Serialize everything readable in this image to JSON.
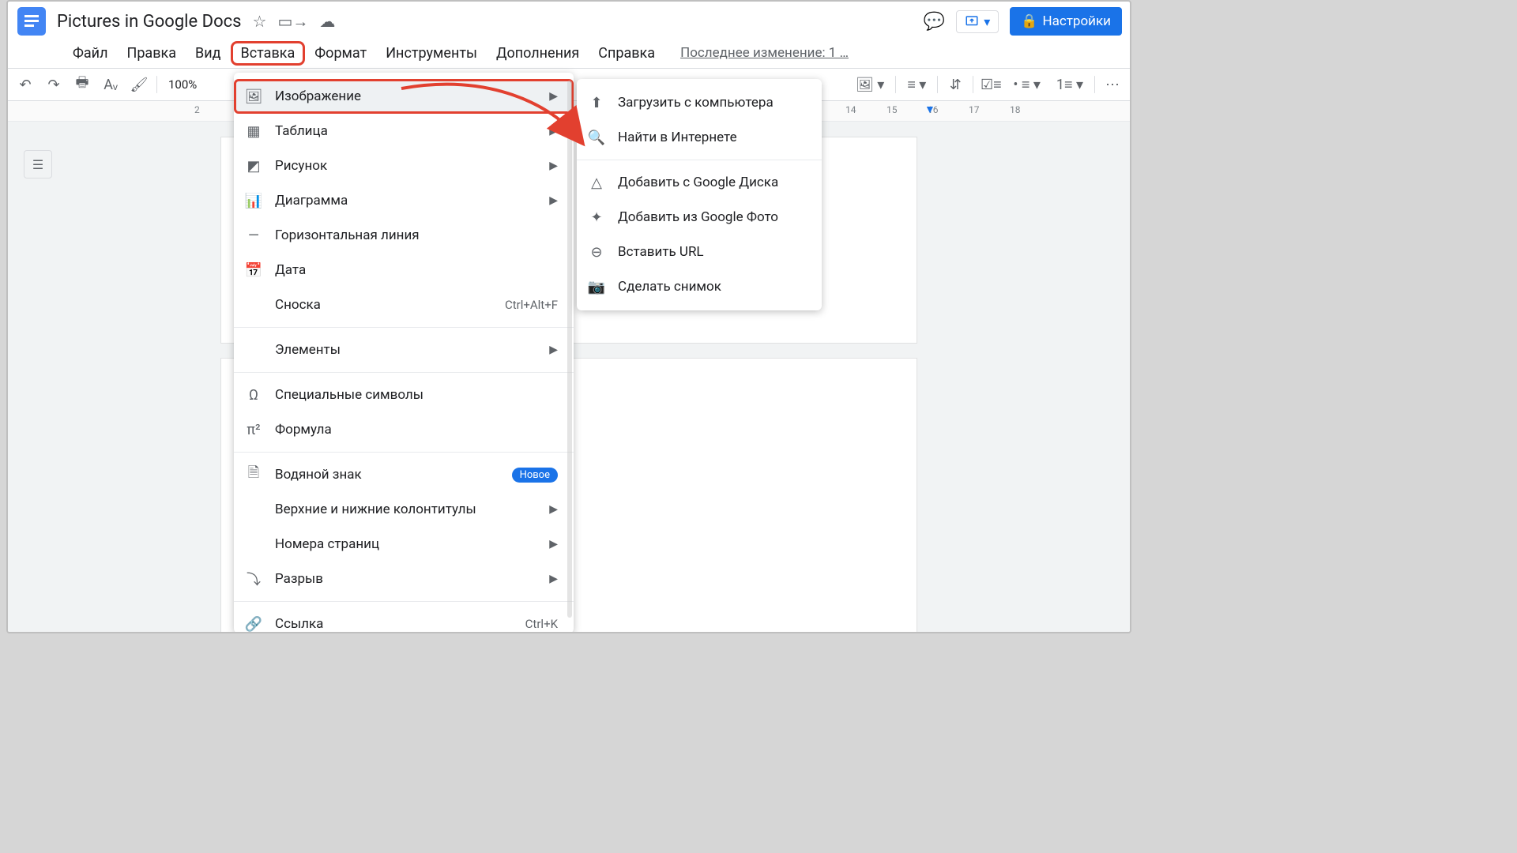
{
  "title": "Pictures in Google Docs",
  "lastedit": "Последнее изменение: 1 …",
  "share": "Настройки",
  "zoom": "100%",
  "menubar": [
    "Файл",
    "Правка",
    "Вид",
    "Вставка",
    "Формат",
    "Инструменты",
    "Дополнения",
    "Справка"
  ],
  "menubar_boxed_index": 3,
  "ruler_labels": [
    "2",
    "14",
    "15",
    "16",
    "17",
    "18"
  ],
  "insert_menu": [
    {
      "ico": "image",
      "label": "Изображение",
      "arrow": true,
      "selected": true,
      "boxed": true
    },
    {
      "ico": "table",
      "label": "Таблица",
      "arrow": true
    },
    {
      "ico": "drawing",
      "label": "Рисунок",
      "arrow": true
    },
    {
      "ico": "chart",
      "label": "Диаграмма",
      "arrow": true
    },
    {
      "ico": "hr",
      "label": "Горизонтальная линия"
    },
    {
      "ico": "date",
      "label": "Дата"
    },
    {
      "ico": "",
      "label": "Сноска",
      "shortcut": "Ctrl+Alt+F"
    },
    {
      "divider": true
    },
    {
      "ico": "",
      "label": "Элементы",
      "arrow": true
    },
    {
      "divider": true
    },
    {
      "ico": "omega",
      "label": "Специальные символы"
    },
    {
      "ico": "pi",
      "label": "Формула"
    },
    {
      "divider": true
    },
    {
      "ico": "watermark",
      "label": "Водяной знак",
      "badge": "Новое"
    },
    {
      "ico": "",
      "label": "Верхние и нижние колонтитулы",
      "arrow": true
    },
    {
      "ico": "",
      "label": "Номера страниц",
      "arrow": true
    },
    {
      "ico": "break",
      "label": "Разрыв",
      "arrow": true
    },
    {
      "divider": true
    },
    {
      "ico": "link",
      "label": "Ссылка",
      "shortcut": "Ctrl+K"
    }
  ],
  "image_submenu": [
    {
      "ico": "upload",
      "label": "Загрузить с компьютера"
    },
    {
      "ico": "search",
      "label": "Найти в Интернете"
    },
    {
      "divider": true
    },
    {
      "ico": "drive",
      "label": "Добавить с Google Диска"
    },
    {
      "ico": "photos",
      "label": "Добавить из Google Фото"
    },
    {
      "ico": "linkurl",
      "label": "Вставить URL"
    },
    {
      "ico": "camera",
      "label": "Сделать снимок"
    }
  ],
  "icons": {
    "image": "🖼",
    "table": "▦",
    "drawing": "◩",
    "chart": "📊",
    "hr": "—",
    "date": "📅",
    "omega": "Ω",
    "pi": "π²",
    "watermark": "🗎",
    "break": "⤵",
    "link": "🔗",
    "upload": "⬆",
    "search": "🔍",
    "drive": "△",
    "photos": "✦",
    "linkurl": "⊖",
    "camera": "📷"
  }
}
